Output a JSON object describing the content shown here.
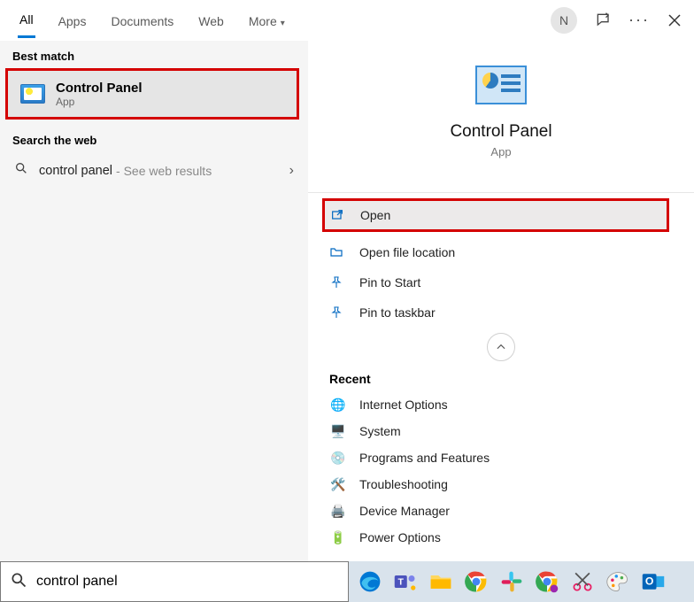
{
  "header": {
    "tabs": [
      "All",
      "Apps",
      "Documents",
      "Web",
      "More"
    ],
    "active_tab": 0,
    "avatar_initial": "N"
  },
  "left": {
    "best_match_label": "Best match",
    "best_match": {
      "title": "Control Panel",
      "subtitle": "App"
    },
    "search_web_label": "Search the web",
    "web_query": "control panel",
    "web_hint": " - See web results"
  },
  "detail": {
    "title": "Control Panel",
    "subtitle": "App",
    "actions": [
      "Open",
      "Open file location",
      "Pin to Start",
      "Pin to taskbar"
    ],
    "recent_label": "Recent",
    "recent": [
      "Internet Options",
      "System",
      "Programs and Features",
      "Troubleshooting",
      "Device Manager",
      "Power Options"
    ]
  },
  "search_input": "control panel",
  "taskbar_icons": [
    "edge",
    "teams",
    "file-explorer",
    "chrome",
    "slack",
    "chrome-canary",
    "snip",
    "paint",
    "outlook"
  ]
}
